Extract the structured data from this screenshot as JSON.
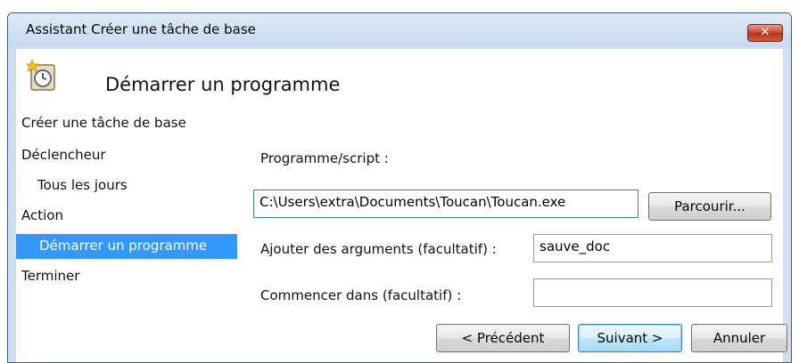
{
  "window": {
    "title": "Assistant Créer une tâche de base",
    "close_label": "✕"
  },
  "header": {
    "title": "Démarrer un programme",
    "icon": "scheduled-task-clock-icon"
  },
  "sidebar": {
    "heading": "Créer une tâche de base",
    "items": [
      {
        "label": "Déclencheur"
      },
      {
        "label": "Tous les jours"
      },
      {
        "label": "Action"
      },
      {
        "label": "Démarrer un programme",
        "selected": true
      },
      {
        "label": "Terminer"
      }
    ]
  },
  "form": {
    "program_label": "Programme/script :",
    "program_value": "C:\\Users\\extra\\Documents\\Toucan\\Toucan.exe",
    "browse_label": "Parcourir...",
    "args_label": "Ajouter des arguments (facultatif) :",
    "args_value": "sauve_doc",
    "startin_label": "Commencer dans (facultatif) :",
    "startin_value": ""
  },
  "buttons": {
    "previous": "< Précédent",
    "next": "Suivant >",
    "cancel": "Annuler"
  },
  "colors": {
    "selection": "#3399ff",
    "titlebar": "#c6d9ef",
    "close": "#c8442a"
  }
}
